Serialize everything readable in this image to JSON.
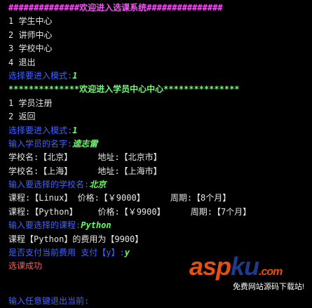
{
  "lines": [
    {
      "text": "##############欢迎进入选课系统###############",
      "color": "#ff4dff"
    },
    {
      "text": "1 学生中心",
      "color": "#e6e6e6"
    },
    {
      "text": "2 讲师中心",
      "color": "#e6e6e6"
    },
    {
      "text": "3 学校中心",
      "color": "#e6e6e6"
    },
    {
      "text": "4 退出",
      "color": "#e6e6e6"
    },
    {
      "prompt": "选择要进入模式:",
      "input": "1"
    },
    {
      "text": "**************欢迎进入学员中心中心***************",
      "color": "#6bff6b"
    },
    {
      "text": "1 学员注册",
      "color": "#e6e6e6"
    },
    {
      "text": "2 返回",
      "color": "#e6e6e6"
    },
    {
      "prompt": "选择要进入模式:",
      "input": "1"
    },
    {
      "prompt": "输入学员的名字:",
      "input": "逵志雷"
    },
    {
      "text": "学校名:【北京】     地址:【北京市】",
      "color": "#e6e6e6"
    },
    {
      "text": "学校名:【上海】     地址:【上海市】",
      "color": "#e6e6e6"
    },
    {
      "prompt": "输入要选择的学校名:",
      "input": "北京"
    },
    {
      "text": "课程:【Linux】 价格:【￥9000】     周期:【8个月】",
      "color": "#e6e6e6"
    },
    {
      "text": "课程:【Python】    价格:【￥9900】     周期:【7个月】",
      "color": "#e6e6e6"
    },
    {
      "prompt": "输入要选择的课程:",
      "input": "Python"
    },
    {
      "text": "课程【Python】的费用为【9900】",
      "color": "#e6e6e6"
    },
    {
      "prompt": "是否支付当前费用 支付【y】:",
      "input": "y"
    },
    {
      "text": "选课成功",
      "color": "#ff5a5a"
    },
    {
      "prompt": "输入任意键退出当前:",
      "input": ""
    }
  ],
  "watermark": {
    "logo_part1": "asp",
    "logo_part2": "ku",
    "logo_suffix": ".com",
    "subtitle": "免费网站源码下载站!"
  }
}
